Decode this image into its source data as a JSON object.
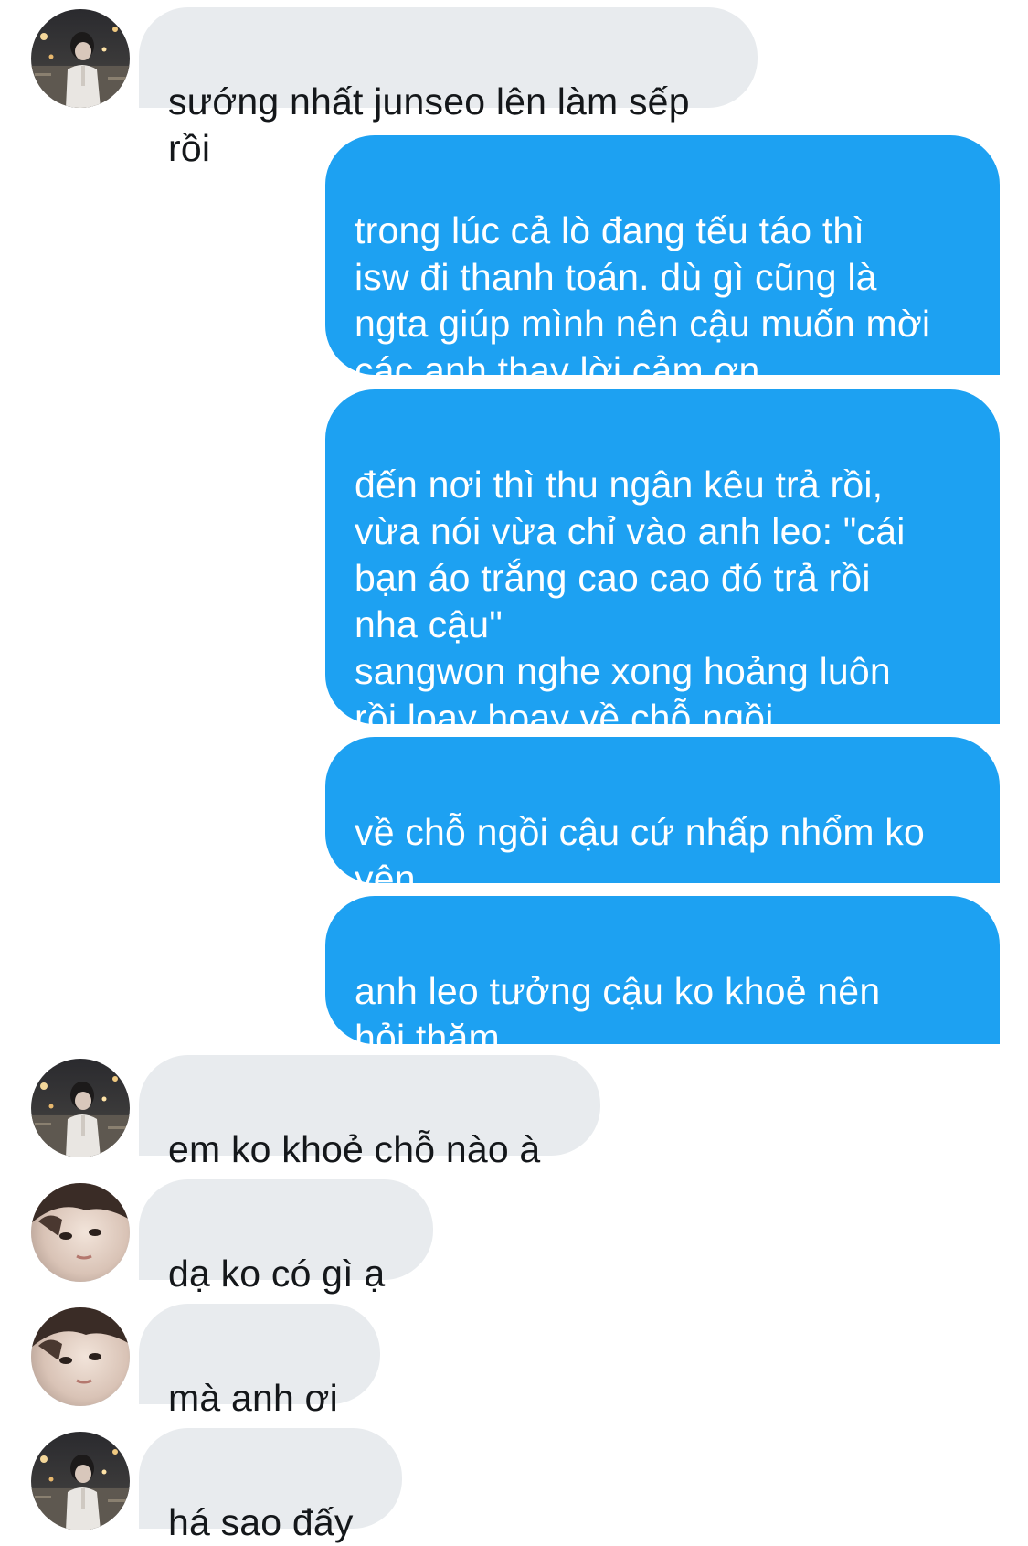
{
  "conversation": {
    "messages": [
      {
        "id": 1,
        "direction": "incoming",
        "sender_avatar": "avatar-a",
        "text": "sướng nhất junseo lên làm sếp rồi"
      },
      {
        "id": 2,
        "direction": "outgoing",
        "text": "trong lúc cả lò đang tếu táo thì\nisw đi thanh toán. dù gì cũng là\nngta giúp mình nên cậu muốn mời\ncác anh thay lời cảm ơn"
      },
      {
        "id": 3,
        "direction": "outgoing",
        "text": "đến nơi thì thu ngân kêu trả rồi,\nvừa nói vừa chỉ vào anh leo: \"cái\nbạn áo trắng cao cao đó trả rồi\nnha cậu\"\nsangwon nghe xong hoảng luôn\nrồi loay hoay về chỗ ngồi"
      },
      {
        "id": 4,
        "direction": "outgoing",
        "text": "về chỗ ngồi cậu cứ nhấp nhổm ko\nyên"
      },
      {
        "id": 5,
        "direction": "outgoing",
        "text": "anh leo tưởng cậu ko khoẻ nên\nhỏi thăm"
      },
      {
        "id": 6,
        "direction": "incoming",
        "sender_avatar": "avatar-a",
        "text": "em ko khoẻ chỗ nào à"
      },
      {
        "id": 7,
        "direction": "incoming",
        "sender_avatar": "avatar-b",
        "text": "dạ ko có gì ạ"
      },
      {
        "id": 8,
        "direction": "incoming",
        "sender_avatar": "avatar-b",
        "text": "mà anh ơi"
      },
      {
        "id": 9,
        "direction": "incoming",
        "sender_avatar": "avatar-a",
        "text": "há sao đấy"
      }
    ]
  },
  "colors": {
    "incoming_bubble": "#e8ebee",
    "incoming_text": "#14171a",
    "outgoing_bubble": "#1da1f2",
    "outgoing_text": "#ffffff",
    "background": "#ffffff"
  },
  "icons": {
    "avatar-a": "profile-photo-night-street",
    "avatar-b": "profile-photo-closeup-face"
  }
}
